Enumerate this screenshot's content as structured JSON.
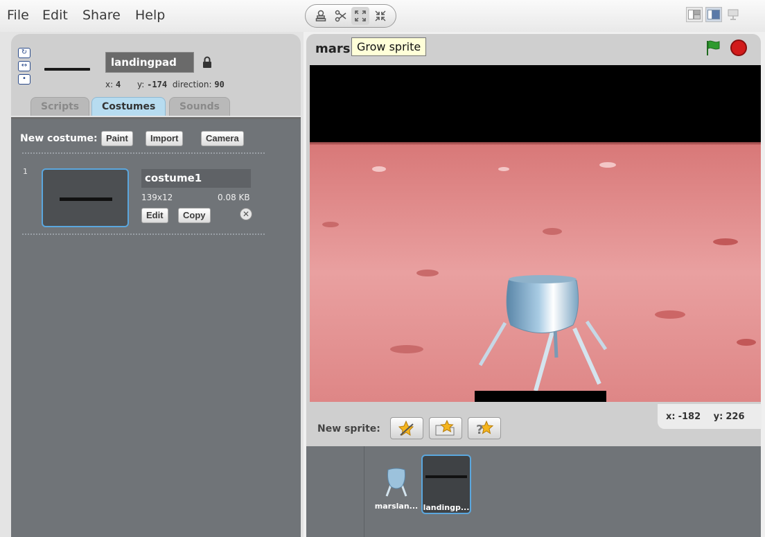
{
  "menu": {
    "items": [
      "File",
      "Edit",
      "Share",
      "Help"
    ]
  },
  "toolbar": {
    "icons": [
      "duplicate-stamp-icon",
      "delete-scissors-icon",
      "grow-sprite-icon",
      "shrink-sprite-icon"
    ]
  },
  "view_modes": [
    "small-stage-icon",
    "normal-stage-icon",
    "presentation-mode-icon"
  ],
  "sprite_info": {
    "name": "landingpad",
    "x_label": "x:",
    "x_value": "4",
    "y_label": "y:",
    "y_value": "-174",
    "direction_label": "direction:",
    "direction_value": "90"
  },
  "tabs": [
    {
      "label": "Scripts",
      "active": false
    },
    {
      "label": "Costumes",
      "active": true
    },
    {
      "label": "Sounds",
      "active": false
    }
  ],
  "costumes_panel": {
    "new_costume_label": "New costume:",
    "paint_label": "Paint",
    "import_label": "Import",
    "camera_label": "Camera",
    "costume": {
      "number": "1",
      "name": "costume1",
      "dimensions": "139x12",
      "size": "0.08 KB",
      "edit_label": "Edit",
      "copy_label": "Copy"
    }
  },
  "stage": {
    "title": "mars",
    "tooltip": "Grow sprite"
  },
  "mouse": {
    "x_label": "x:",
    "x_value": "-182",
    "y_label": "y:",
    "y_value": "226"
  },
  "sprite_bar": {
    "new_sprite_label": "New sprite:"
  },
  "sprites": [
    {
      "label": "marslan...",
      "selected": false
    },
    {
      "label": "landingp...",
      "selected": true
    }
  ],
  "colors": {
    "mars_ground": "#e89a9a",
    "sky": "#000000",
    "stop": "#d21b1b",
    "flag": "#2e9a2e",
    "selection": "#5ba7de"
  }
}
